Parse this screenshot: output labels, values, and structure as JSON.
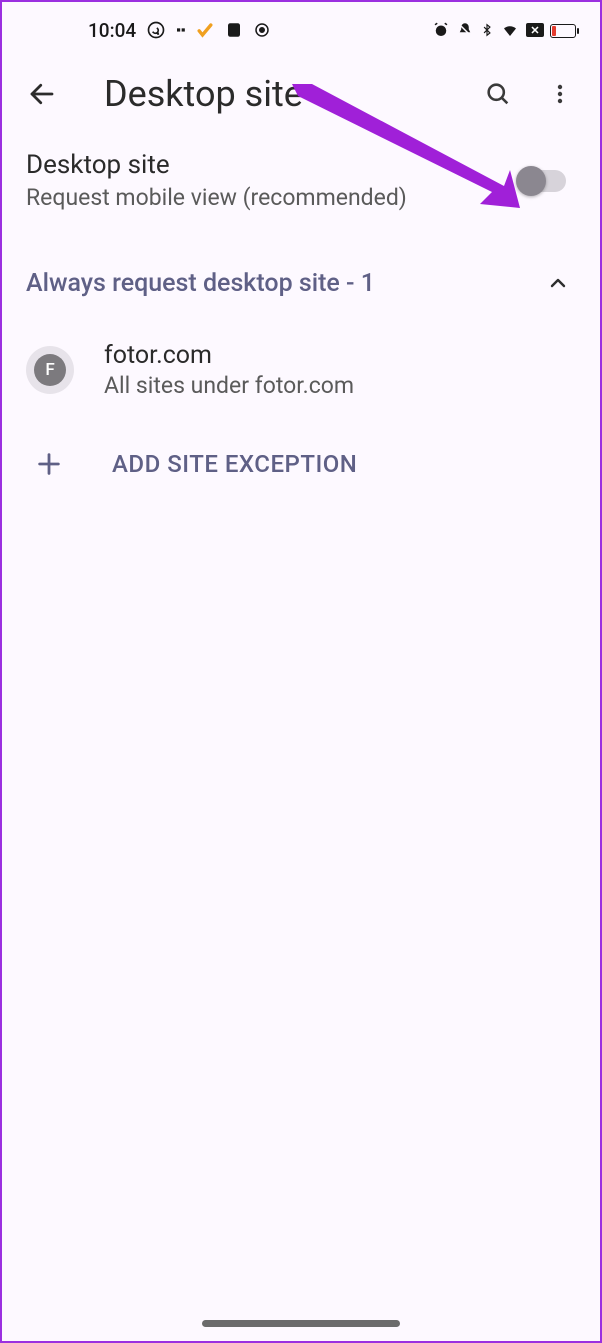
{
  "status": {
    "time": "10:04"
  },
  "appbar": {
    "title": "Desktop site"
  },
  "pref": {
    "title": "Desktop site",
    "subtitle": "Request mobile view (recommended)",
    "toggle_on": false
  },
  "section": {
    "label": "Always request desktop site - 1",
    "expanded": true
  },
  "sites": [
    {
      "favicon_letter": "F",
      "name": "fotor.com",
      "subtitle": "All sites under fotor.com"
    }
  ],
  "add_exception": {
    "label": "ADD SITE EXCEPTION"
  },
  "annotation": {
    "arrow_color": "#a020d8"
  }
}
